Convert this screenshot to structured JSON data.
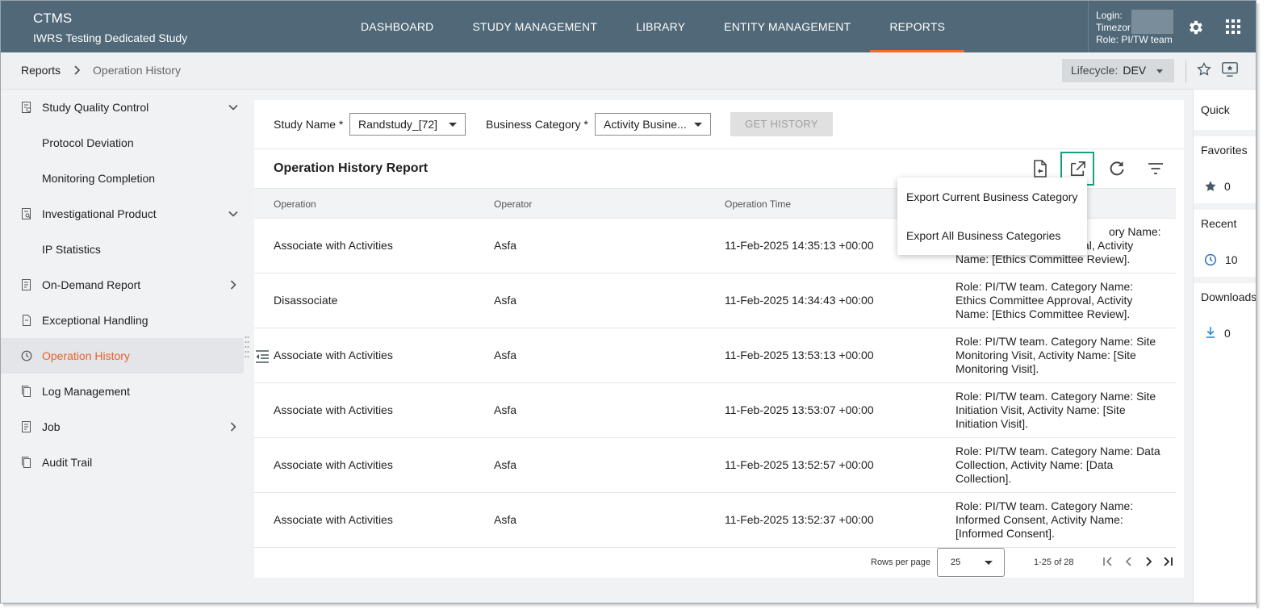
{
  "header": {
    "app_name": "CTMS",
    "study_name": "IWRS Testing Dedicated Study",
    "nav": [
      "DASHBOARD",
      "STUDY MANAGEMENT",
      "LIBRARY",
      "ENTITY MANAGEMENT",
      "REPORTS"
    ],
    "active_nav": "REPORTS",
    "login_label": "Login:",
    "timezone_label": "Timezor",
    "role_label": "Role:",
    "role_value": "PI/TW team"
  },
  "breadcrumb": {
    "root": "Reports",
    "current": "Operation History"
  },
  "lifecycle": {
    "label": "Lifecycle:",
    "value": "DEV"
  },
  "sidebar": {
    "items": [
      {
        "label": "Study Quality Control",
        "icon": "report-check-icon",
        "chevron": "down"
      },
      {
        "label": "Protocol Deviation",
        "sub": true
      },
      {
        "label": "Monitoring Completion",
        "sub": true
      },
      {
        "label": "Investigational Product",
        "icon": "report-search-icon",
        "chevron": "down"
      },
      {
        "label": "IP Statistics",
        "sub": true
      },
      {
        "label": "On-Demand Report",
        "icon": "report-list-icon",
        "chevron": "right"
      },
      {
        "label": "Exceptional Handling",
        "icon": "document-icon"
      },
      {
        "label": "Operation History",
        "icon": "clock-icon",
        "active": true
      },
      {
        "label": "Log Management",
        "icon": "copy-icon"
      },
      {
        "label": "Job",
        "icon": "report-list-icon",
        "chevron": "right"
      },
      {
        "label": "Audit Trail",
        "icon": "copy-icon"
      }
    ]
  },
  "filters": {
    "study_label": "Study Name *",
    "study_value": "Randstudy_[72]",
    "category_label": "Business Category *",
    "category_value": "Activity Busine...",
    "get_history": "GET HISTORY"
  },
  "report": {
    "title": "Operation History Report",
    "columns": [
      "Operation",
      "Operator",
      "Operation Time",
      ""
    ],
    "rows": [
      {
        "operation": "Associate with Activities",
        "operator": "Asfa",
        "time": "11-Feb-2025 14:35:13 +00:00",
        "detail": [
          "",
          "ory Name:",
          "al, Activity",
          "Name: [Ethics Committee Review]."
        ]
      },
      {
        "operation": "Disassociate",
        "operator": "Asfa",
        "time": "11-Feb-2025 14:34:43 +00:00",
        "detail": [
          "Role: PI/TW team. Category Name:",
          "Ethics Committee Approval, Activity",
          "Name: [Ethics Committee Review]."
        ]
      },
      {
        "operation": "Associate with Activities",
        "operator": "Asfa",
        "time": "11-Feb-2025 13:53:13 +00:00",
        "detail": [
          "Role: PI/TW team. Category Name: Site",
          "Monitoring Visit, Activity Name: [Site",
          "Monitoring Visit]."
        ]
      },
      {
        "operation": "Associate with Activities",
        "operator": "Asfa",
        "time": "11-Feb-2025 13:53:07 +00:00",
        "detail": [
          "Role: PI/TW team. Category Name: Site",
          "Initiation Visit, Activity Name: [Site",
          "Initiation Visit]."
        ]
      },
      {
        "operation": "Associate with Activities",
        "operator": "Asfa",
        "time": "11-Feb-2025 13:52:57 +00:00",
        "detail": [
          "Role: PI/TW team. Category Name: Data",
          "Collection, Activity Name: [Data",
          "Collection]."
        ]
      },
      {
        "operation": "Associate with Activities",
        "operator": "Asfa",
        "time": "11-Feb-2025 13:52:37 +00:00",
        "detail": [
          "Role: PI/TW team. Category Name:",
          "Informed Consent, Activity Name:",
          "[Informed Consent]."
        ]
      }
    ],
    "rows_per_page_label": "Rows per page",
    "rows_per_page": "25",
    "range": "1-25 of 28"
  },
  "export_menu": {
    "items": [
      "Export Current Business Category",
      "Export All Business Categories"
    ]
  },
  "right_panel": {
    "quick": "Quick",
    "favorites": "Favorites",
    "favorites_count": "0",
    "recent": "Recent",
    "recent_count": "10",
    "downloads": "Downloads",
    "downloads_count": "0"
  },
  "colors": {
    "header_bg": "#506878",
    "accent": "#e8622a",
    "highlight": "#17a085"
  }
}
